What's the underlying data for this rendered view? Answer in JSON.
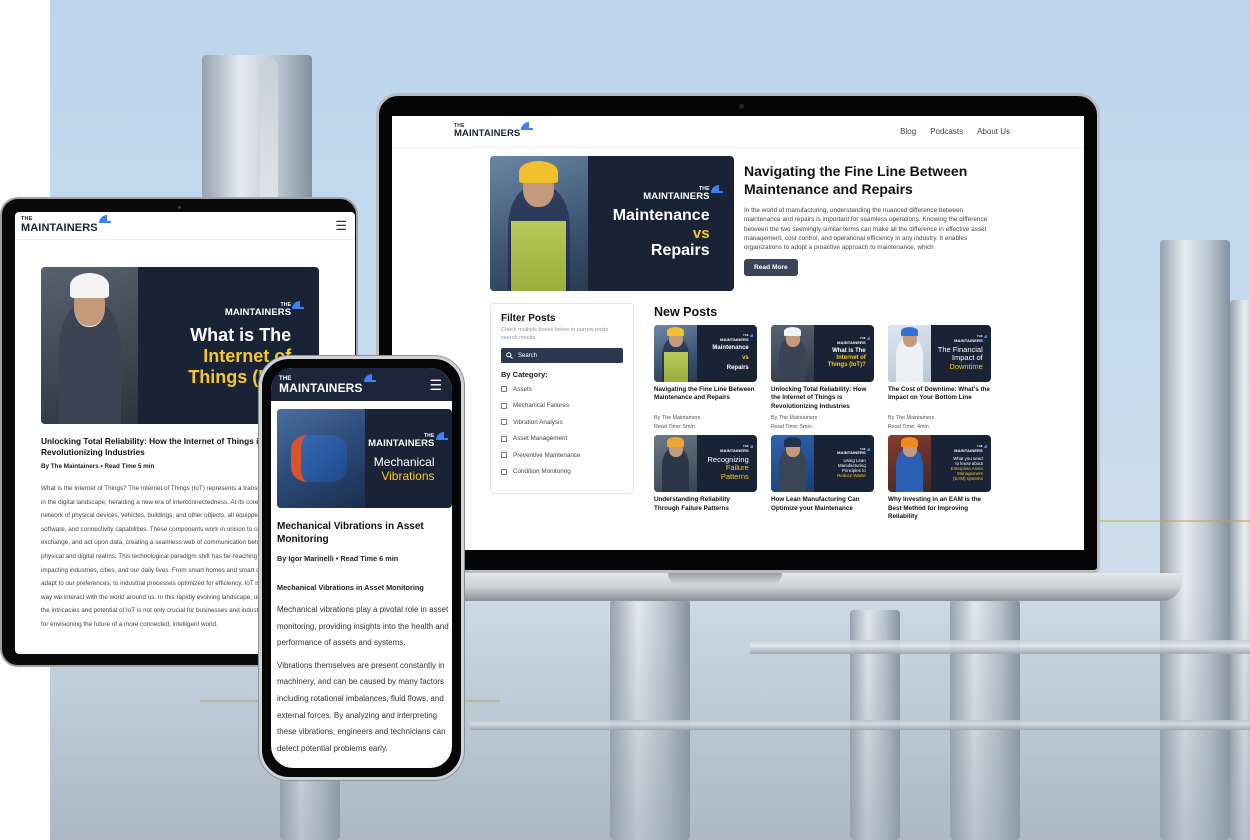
{
  "brand": {
    "the": "THE",
    "name": "MAINTAINERS",
    "accent_color": "#3b82f6",
    "navy_color": "#1a2336",
    "highlight_color": "#f5c928"
  },
  "laptop": {
    "nav": [
      {
        "label": "Blog"
      },
      {
        "label": "Podcasts"
      },
      {
        "label": "About Us"
      }
    ],
    "hero": {
      "banner": {
        "line1": "Maintenance",
        "line2": "vs",
        "line3": "Repairs"
      },
      "title": "Navigating the Fine Line Between Maintenance and Repairs",
      "excerpt": "In the world of manufacturing, understanding the nuanced difference between maintenance and repairs is important for seamless operations. Knowing the difference between the two seemingly similar terms can make all the difference in effective asset management, cost control, and operational efficiency in any industry. It enables organizations to adopt a proactive approach to maintenance, which",
      "read_more": "Read More"
    },
    "filter": {
      "title": "Filter Posts",
      "subtitle": "Check multiple boxes below to narrow posts search results",
      "search_placeholder": "Search",
      "category_label": "By Category:",
      "categories": [
        {
          "label": "Assets",
          "checked": false
        },
        {
          "label": "Mechanical Failures",
          "checked": false
        },
        {
          "label": "Vibration Analysis",
          "checked": false
        },
        {
          "label": "Asset Management",
          "checked": false
        },
        {
          "label": "Preventive Maintenance",
          "checked": false
        },
        {
          "label": "Condition Monitoring",
          "checked": false
        }
      ]
    },
    "new_posts": {
      "heading": "New Posts",
      "posts": [
        {
          "thumb": [
            "Maintenance",
            "vs",
            "Repairs"
          ],
          "title": "Navigating the Fine Line Between Maintenance and Repairs",
          "author": "By The Maintainers",
          "read_time": "Read Time: 5min"
        },
        {
          "thumb": [
            "What is The",
            "Internet of",
            "Things (IoT)?"
          ],
          "title": "Unlocking Total Reliability: How the Internet of Things is Revolutionizing Industries",
          "author": "By The Maintainers",
          "read_time": "Read Time: 5min"
        },
        {
          "thumb": [
            "The Financial",
            "Impact of",
            "Downtime"
          ],
          "title": "The Cost of Downtime: What's the Impact on Your Bottom Line",
          "author": "By The Maintainers",
          "read_time": "Read Time: 4min"
        },
        {
          "thumb": [
            "Recognizing",
            "Failure",
            "Patterns"
          ],
          "title": "Understanding Reliability Through Failure Patterns"
        },
        {
          "thumb": [
            "Using Lean",
            "Manufacturing",
            "Principles to",
            "Reduce Waste"
          ],
          "title": "How Lean Manufacturing Can Optimize your Maintenance"
        },
        {
          "thumb": [
            "What you need",
            "to know about",
            "Enterprise Asset",
            "Management",
            "(EAM) systems"
          ],
          "title": "Why Investing in an EAM is the Best Method for Improving Reliability"
        }
      ]
    }
  },
  "tablet": {
    "banner": {
      "line1": "What is The",
      "line2": "Internet of",
      "line3": "Things (IoT)"
    },
    "title": "Unlocking Total Reliability: How the Internet of Things is Revolutionizing Industries",
    "meta": "By The Maintainers • Read Time 5 min",
    "body": "What is the Internet of Things? The Internet of Things (IoT) represents a transformative force in the digital landscape, heralding a new era of interconnectedness. At its core, IoT is a network of physical devices, vehicles, buildings, and other objects, all equipped with sensors, software, and connectivity capabilities. These components work in unison to collect, exchange, and act upon data, creating a seamless web of communication between the physical and digital realms. This technological paradigm shift has far-reaching implications, impacting industries, cities, and our daily lives. From smart homes and smart devices that adapt to our preferences, to industrial processes optimized for efficiency, IoT is reshaping the way we interact with the world around us. In this rapidly evolving landscape, understanding the intricacies and potential of IoT is not only crucial for businesses and industries but also for envisioning the future of a more connected, intelligent world."
  },
  "phone": {
    "banner": {
      "line1": "Mechanical",
      "line2": "Vibrations"
    },
    "title": "Mechanical Vibrations in Asset Monitoring",
    "meta": "By Igor Marinelli • Read Time 6 min",
    "subheading": "Mechanical Vibrations in Asset Monitoring",
    "paragraphs": [
      "Mechanical vibrations play a pivotal role in asset monitoring, providing insights into the health and performance of assets and systems.",
      "Vibrations themselves are present constantly in machinery, and can be caused by many factors including rotational imbalances, fluid flows, and external forces. By analyzing and interpreting these vibrations, engineers and technicians can detect potential problems early."
    ]
  }
}
